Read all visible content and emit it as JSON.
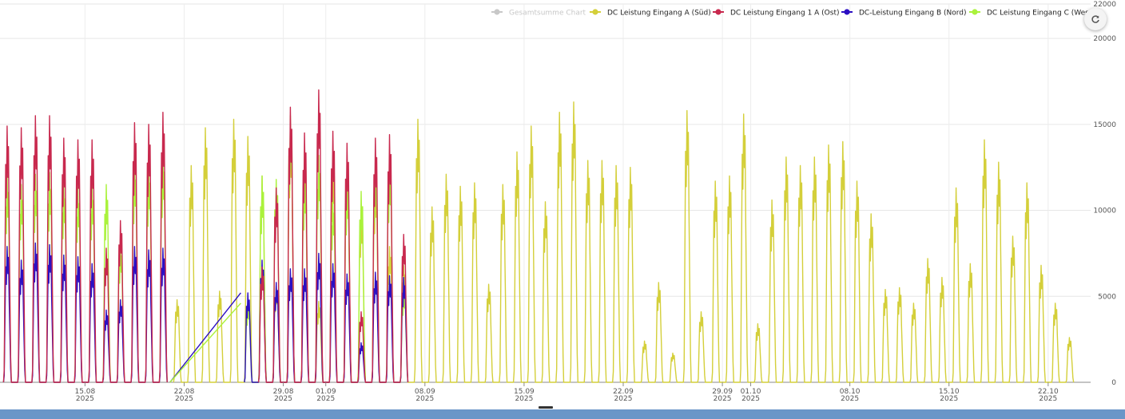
{
  "chart_data": {
    "type": "line",
    "x_unit": "day",
    "x_range": [
      "2025-08-09T00:00",
      "2025-10-25T00:00"
    ],
    "ylim": [
      0,
      22000
    ],
    "y_ticks": [
      0,
      5000,
      10000,
      15000,
      20000,
      22000
    ],
    "x_tick_labels": [
      {
        "date": "2025-08-15",
        "day": "15.08",
        "year": "2025"
      },
      {
        "date": "2025-08-22",
        "day": "22.08",
        "year": "2025"
      },
      {
        "date": "2025-08-29",
        "day": "29.08",
        "year": "2025"
      },
      {
        "date": "2025-09-01",
        "day": "01.09",
        "year": "2025"
      },
      {
        "date": "2025-09-08",
        "day": "08.09",
        "year": "2025"
      },
      {
        "date": "2025-09-15",
        "day": "15.09",
        "year": "2025"
      },
      {
        "date": "2025-09-22",
        "day": "22.09",
        "year": "2025"
      },
      {
        "date": "2025-09-29",
        "day": "29.09",
        "year": "2025"
      },
      {
        "date": "2025-10-01",
        "day": "01.10",
        "year": "2025"
      },
      {
        "date": "2025-10-08",
        "day": "08.10",
        "year": "2025"
      },
      {
        "date": "2025-10-15",
        "day": "15.10",
        "year": "2025"
      },
      {
        "date": "2025-10-22",
        "day": "22.10",
        "year": "2025"
      }
    ],
    "grid": true,
    "legend_position": "top-right",
    "series": [
      {
        "name": "Gesamtsumme Chart",
        "color": "#c8c8c8",
        "visible": false,
        "daily_peaks": []
      },
      {
        "name": "DC Leistung Eingang A (Süd)",
        "color": "#d4cf3a",
        "visible": true,
        "daily_peaks": [
          [
            "2025-08-21",
            4800
          ],
          [
            "2025-08-22",
            12600
          ],
          [
            "2025-08-23",
            14800
          ],
          [
            "2025-08-24",
            5300
          ],
          [
            "2025-08-25",
            15300
          ],
          [
            "2025-08-26",
            14300
          ],
          [
            "2025-08-27",
            12000
          ],
          [
            "2025-08-28",
            5700
          ],
          [
            "2025-08-29",
            14900
          ],
          [
            "2025-08-30",
            13400
          ],
          [
            "2025-08-31",
            4700
          ],
          [
            "2025-09-01",
            13000
          ],
          [
            "2025-09-02",
            12200
          ],
          [
            "2025-09-03",
            10100
          ],
          [
            "2025-09-04",
            12000
          ],
          [
            "2025-09-05",
            7900
          ],
          [
            "2025-09-06",
            6800
          ],
          [
            "2025-09-07",
            15300
          ],
          [
            "2025-09-08",
            10200
          ],
          [
            "2025-09-09",
            12100
          ],
          [
            "2025-09-10",
            11400
          ],
          [
            "2025-09-11",
            11600
          ],
          [
            "2025-09-12",
            5700
          ],
          [
            "2025-09-13",
            11500
          ],
          [
            "2025-09-14",
            13400
          ],
          [
            "2025-09-15",
            14900
          ],
          [
            "2025-09-16",
            10500
          ],
          [
            "2025-09-17",
            15700
          ],
          [
            "2025-09-18",
            16300
          ],
          [
            "2025-09-19",
            12900
          ],
          [
            "2025-09-20",
            12900
          ],
          [
            "2025-09-21",
            12600
          ],
          [
            "2025-09-22",
            12500
          ],
          [
            "2025-09-23",
            2400
          ],
          [
            "2025-09-24",
            5800
          ],
          [
            "2025-09-25",
            1700
          ],
          [
            "2025-09-26",
            15800
          ],
          [
            "2025-09-27",
            4100
          ],
          [
            "2025-09-28",
            11700
          ],
          [
            "2025-09-29",
            12000
          ],
          [
            "2025-09-30",
            15600
          ],
          [
            "2025-10-01",
            3400
          ],
          [
            "2025-10-02",
            10600
          ],
          [
            "2025-10-03",
            13100
          ],
          [
            "2025-10-04",
            12600
          ],
          [
            "2025-10-05",
            13100
          ],
          [
            "2025-10-06",
            13800
          ],
          [
            "2025-10-07",
            14000
          ],
          [
            "2025-10-08",
            11700
          ],
          [
            "2025-10-09",
            9800
          ],
          [
            "2025-10-10",
            5400
          ],
          [
            "2025-10-11",
            5500
          ],
          [
            "2025-10-12",
            4600
          ],
          [
            "2025-10-13",
            7200
          ],
          [
            "2025-10-14",
            6100
          ],
          [
            "2025-10-15",
            11300
          ],
          [
            "2025-10-16",
            6900
          ],
          [
            "2025-10-17",
            14100
          ],
          [
            "2025-10-18",
            12800
          ],
          [
            "2025-10-19",
            8500
          ],
          [
            "2025-10-20",
            11600
          ],
          [
            "2025-10-21",
            6800
          ],
          [
            "2025-10-22",
            4600
          ],
          [
            "2025-10-23",
            2600
          ]
        ]
      },
      {
        "name": "DC Leistung Eingang 1 A (Ost)",
        "color": "#c8294e",
        "visible": true,
        "daily_peaks": [
          [
            "2025-08-09",
            14900
          ],
          [
            "2025-08-10",
            14800
          ],
          [
            "2025-08-11",
            15500
          ],
          [
            "2025-08-12",
            15500
          ],
          [
            "2025-08-13",
            14200
          ],
          [
            "2025-08-14",
            14100
          ],
          [
            "2025-08-15",
            14100
          ],
          [
            "2025-08-16",
            7800
          ],
          [
            "2025-08-17",
            9400
          ],
          [
            "2025-08-18",
            15100
          ],
          [
            "2025-08-19",
            15000
          ],
          [
            "2025-08-20",
            15700
          ],
          [
            "2025-08-27",
            6700
          ],
          [
            "2025-08-28",
            11300
          ],
          [
            "2025-08-29",
            16000
          ],
          [
            "2025-08-30",
            14500
          ],
          [
            "2025-08-31",
            17000
          ],
          [
            "2025-09-01",
            14600
          ],
          [
            "2025-09-02",
            13900
          ],
          [
            "2025-09-03",
            4100
          ],
          [
            "2025-09-04",
            14200
          ],
          [
            "2025-09-05",
            14400
          ],
          [
            "2025-09-06",
            8600
          ]
        ]
      },
      {
        "name": "DC-Leistung Eingang B (Nord)",
        "color": "#2c0fc2",
        "visible": true,
        "daily_peaks": [
          [
            "2025-08-09",
            7900
          ],
          [
            "2025-08-10",
            7100
          ],
          [
            "2025-08-11",
            8100
          ],
          [
            "2025-08-12",
            8000
          ],
          [
            "2025-08-13",
            7400
          ],
          [
            "2025-08-14",
            7300
          ],
          [
            "2025-08-15",
            6900
          ],
          [
            "2025-08-16",
            4200
          ],
          [
            "2025-08-17",
            4800
          ],
          [
            "2025-08-18",
            7900
          ],
          [
            "2025-08-19",
            7700
          ],
          [
            "2025-08-20",
            7800
          ],
          [
            "2025-08-26",
            5200
          ],
          [
            "2025-08-27",
            7100
          ],
          [
            "2025-08-28",
            5800
          ],
          [
            "2025-08-29",
            6600
          ],
          [
            "2025-08-30",
            6600
          ],
          [
            "2025-08-31",
            7500
          ],
          [
            "2025-09-01",
            6900
          ],
          [
            "2025-09-02",
            6300
          ],
          [
            "2025-09-03",
            2300
          ],
          [
            "2025-09-04",
            6400
          ],
          [
            "2025-09-05",
            6200
          ],
          [
            "2025-09-06",
            6100
          ]
        ]
      },
      {
        "name": "DC Leistung Eingang C (West)",
        "color": "#aaf23c",
        "visible": true,
        "daily_peaks": [
          [
            "2025-08-09",
            12000
          ],
          [
            "2025-08-10",
            11500
          ],
          [
            "2025-08-11",
            12100
          ],
          [
            "2025-08-12",
            12200
          ],
          [
            "2025-08-13",
            11600
          ],
          [
            "2025-08-14",
            11300
          ],
          [
            "2025-08-15",
            11500
          ],
          [
            "2025-08-16",
            11500
          ],
          [
            "2025-08-17",
            8000
          ],
          [
            "2025-08-18",
            12800
          ],
          [
            "2025-08-19",
            12600
          ],
          [
            "2025-08-20",
            13300
          ],
          [
            "2025-08-26",
            4600
          ],
          [
            "2025-08-27",
            12000
          ],
          [
            "2025-08-28",
            11800
          ],
          [
            "2025-08-29",
            15500
          ],
          [
            "2025-08-30",
            12300
          ],
          [
            "2025-08-31",
            13200
          ],
          [
            "2025-09-01",
            10700
          ],
          [
            "2025-09-02",
            11900
          ],
          [
            "2025-09-03",
            11100
          ],
          [
            "2025-09-04",
            12900
          ],
          [
            "2025-09-05",
            12900
          ],
          [
            "2025-09-06",
            5400
          ]
        ]
      }
    ],
    "gap_bridges": [
      {
        "series": "DC-Leistung Eingang B (Nord)",
        "from": [
          "2025-08-21",
          0
        ],
        "to": [
          "2025-08-26",
          5200
        ]
      },
      {
        "series": "DC Leistung Eingang C (West)",
        "from": [
          "2025-08-21",
          0
        ],
        "to": [
          "2025-08-26",
          4600
        ]
      }
    ]
  },
  "toolbar": {
    "refresh_icon": "refresh-icon"
  }
}
